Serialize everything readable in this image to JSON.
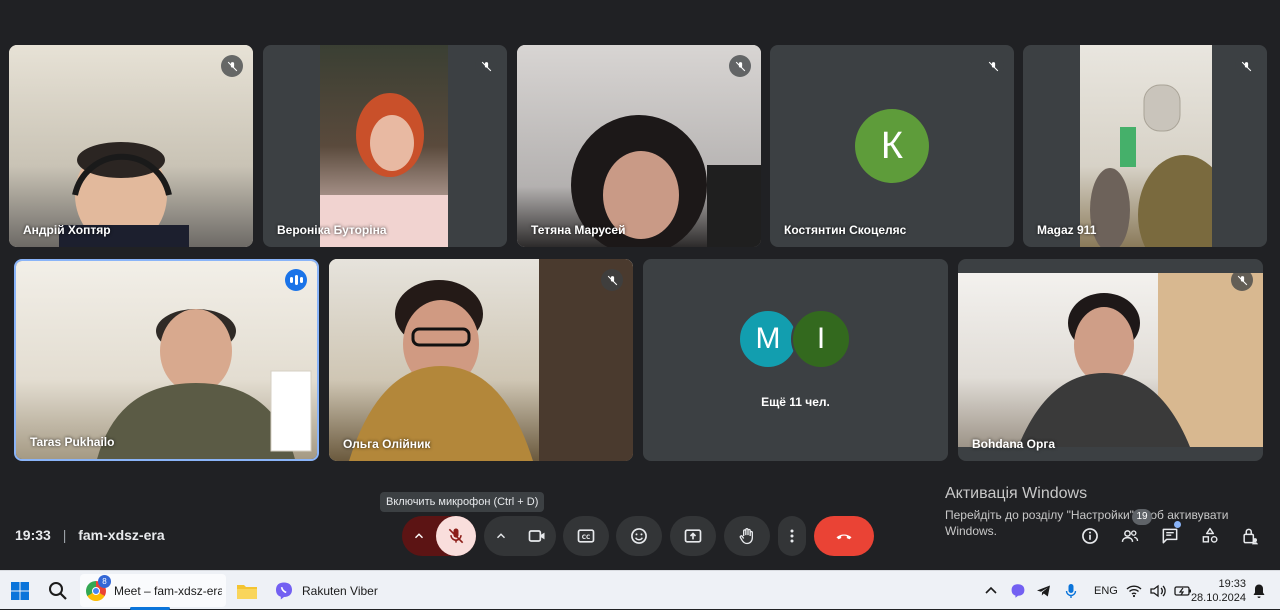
{
  "participants": [
    {
      "name": "Андрій Хоптяр"
    },
    {
      "name": "Вероніка Буторіна"
    },
    {
      "name": "Тетяна Марусей"
    },
    {
      "name": "Костянтин Скоцеляс",
      "initial": "К"
    },
    {
      "name": "Magaz 911"
    },
    {
      "name": "Taras Pukhailo"
    },
    {
      "name": "Ольга Олійник"
    },
    {
      "name": "Bohdana Орга"
    }
  ],
  "others": {
    "initials": [
      "M",
      "I"
    ],
    "label": "Ещё 11 чел."
  },
  "tooltip": "Включить микрофон (Ctrl + D)",
  "activation": {
    "title": "Активація Windows",
    "text": "Перейдіть до розділу \"Настройки\", щоб активувати Windows."
  },
  "meeting": {
    "time": "19:33",
    "separator": "|",
    "code": "fam-xdsz-era"
  },
  "badges": {
    "people": "19"
  },
  "colors": {
    "background": "#202124",
    "tile": "#3c4043",
    "hangup": "#ea4335",
    "mic_off": "#f9dedc",
    "accent": "#1a73e8",
    "avatar_k": "#5e9c3a",
    "avatar_m": "#129eaf",
    "avatar_i": "#33691e"
  },
  "taskbar": {
    "chrome_title": "Meet – fam-xdsz-era - C",
    "chrome_badge": "8",
    "viber_title": "Rakuten Viber",
    "lang": "ENG",
    "time": "19:33",
    "date": "28.10.2024"
  }
}
